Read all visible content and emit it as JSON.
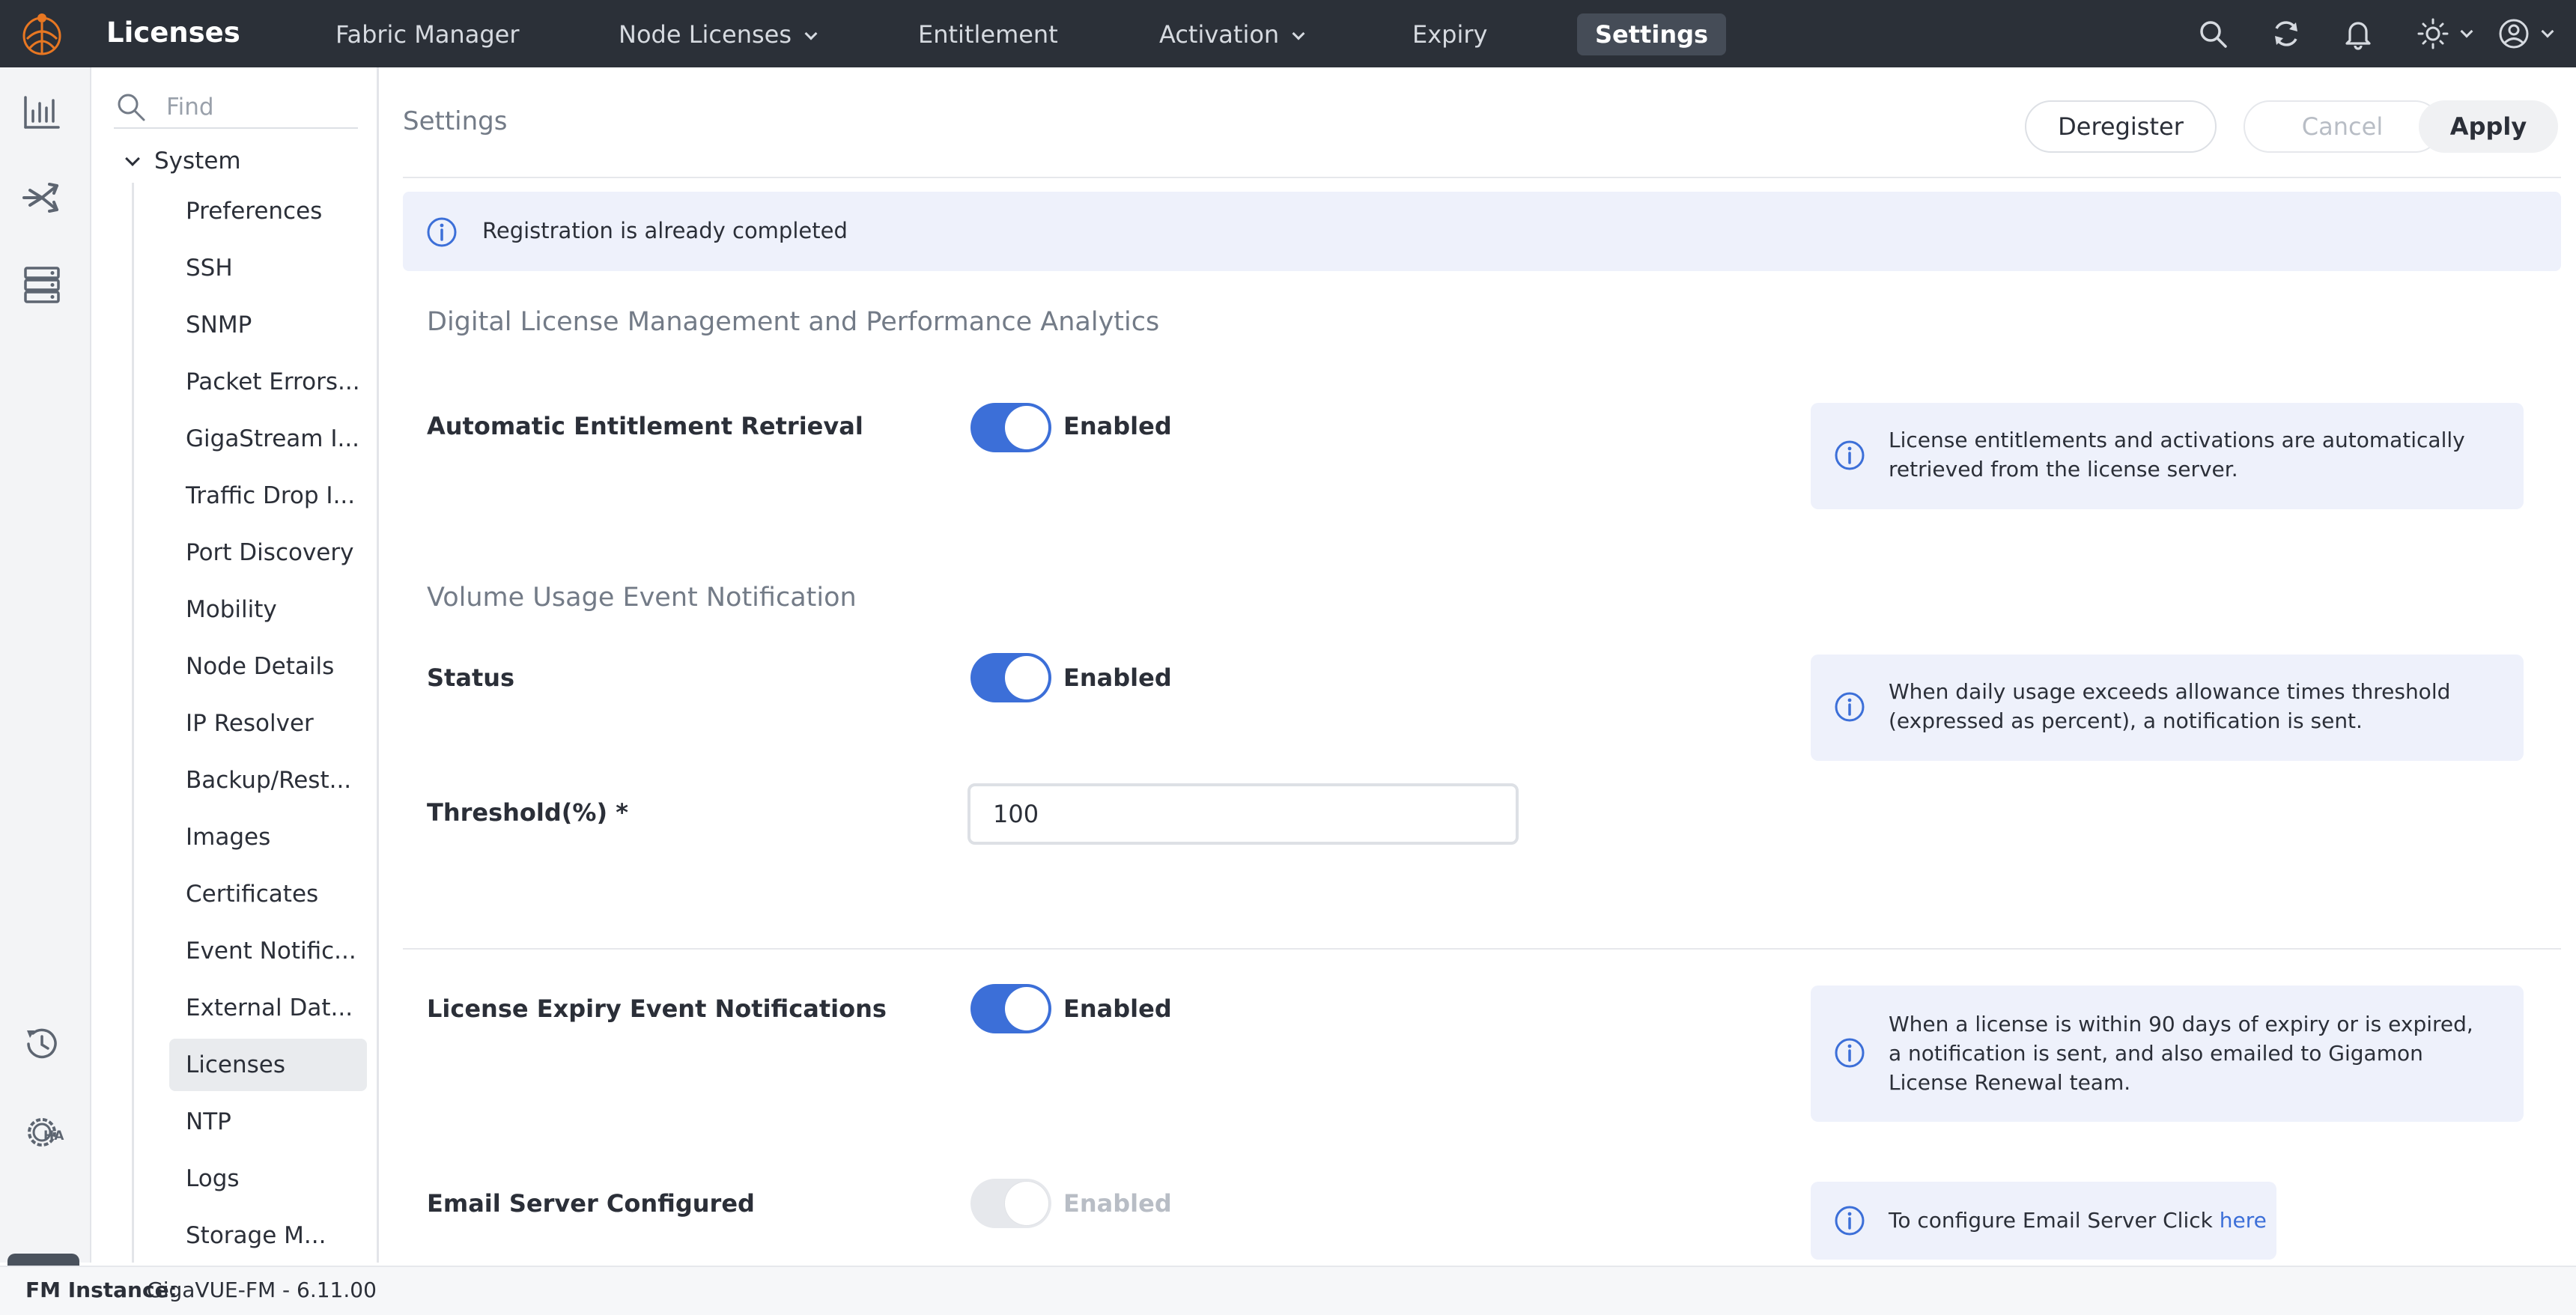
{
  "header": {
    "app_title": "Licenses",
    "nav": [
      {
        "label": "Fabric Manager"
      },
      {
        "label": "Node Licenses"
      },
      {
        "label": "Entitlement"
      },
      {
        "label": "Activation"
      },
      {
        "label": "Expiry"
      },
      {
        "label": "Settings"
      }
    ],
    "active_nav": "Settings",
    "icons": [
      "search-icon",
      "refresh-icon",
      "bell-icon",
      "theme-sun-icon",
      "user-account-icon"
    ]
  },
  "rail": {
    "icons": [
      "analytics-chart-icon",
      "traffic-flow-icon",
      "storage-server-icon",
      "history-icon",
      "ha-gear-icon",
      "settings-gear-icon"
    ]
  },
  "tree": {
    "find_placeholder": "Find",
    "root": "System",
    "items": [
      "Preferences",
      "SSH",
      "SNMP",
      "Packet Errors...",
      "GigaStream I...",
      "Traffic Drop I...",
      "Port Discovery",
      "Mobility",
      "Node Details",
      "IP Resolver",
      "Backup/Rest...",
      "Images",
      "Certificates",
      "Event Notific...",
      "External Dat...",
      "Licenses",
      "NTP",
      "Logs",
      "Storage M..."
    ],
    "selected": "Licenses"
  },
  "main": {
    "title": "Settings",
    "buttons": {
      "deregister": "Deregister",
      "cancel": "Cancel",
      "apply": "Apply"
    },
    "banner": "Registration is already completed",
    "section1_title": "Digital License Management and Performance Analytics",
    "auto_retrieval": {
      "label": "Automatic Entitlement Retrieval",
      "state": "Enabled",
      "on": true,
      "info": "License entitlements and activations are automatically retrieved from the license server."
    },
    "section2_title": "Volume Usage Event Notification",
    "status": {
      "label": "Status",
      "state": "Enabled",
      "on": true,
      "info": "When daily usage exceeds allowance times threshold (expressed as percent), a notification is sent."
    },
    "threshold": {
      "label": "Threshold(%) *",
      "value": "100"
    },
    "expiry": {
      "label": "License Expiry Event Notifications",
      "state": "Enabled",
      "on": true,
      "info": "When a license is within 90 days of expiry or is expired, a notification is sent, and also emailed to Gigamon License Renewal team."
    },
    "email": {
      "label": "Email Server Configured",
      "state": "Enabled",
      "on": false,
      "info_prefix": "To configure Email Server Click ",
      "info_link": "here"
    }
  },
  "footer": {
    "instance_label": "FM Instance:",
    "instance_value": "GigaVUE-FM - 6.11.00"
  },
  "colors": {
    "topbar": "#2b3038",
    "accent": "#3c6fd8",
    "info_bg": "#eef1fb"
  }
}
